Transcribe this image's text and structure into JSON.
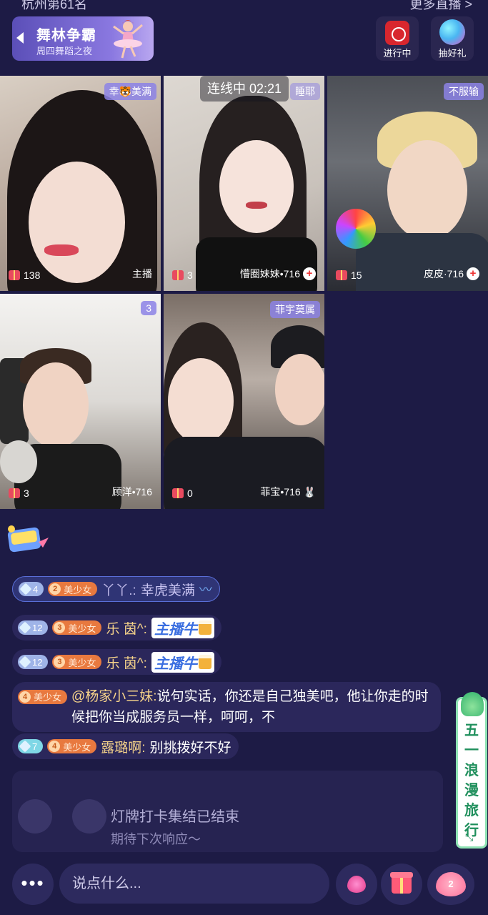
{
  "status": {
    "location": "杭州第61名",
    "more_live": "更多直播 >"
  },
  "event": {
    "title": "舞林争霸",
    "subtitle": "周四舞蹈之夜"
  },
  "top_buttons": {
    "live": "进行中",
    "gift": "抽好礼"
  },
  "timer": "连线中 02:21",
  "tiles": [
    {
      "badge": "幸🐯美满",
      "gift_count": "138",
      "name": "主播",
      "plus": false
    },
    {
      "badge": "睡耶",
      "gift_count": "3",
      "name": "懵圈妹妹•716",
      "plus": true
    },
    {
      "badge": "不服输",
      "gift_count": "15",
      "name": "皮皮·716",
      "plus": true
    },
    {
      "badge": "3",
      "gift_count": "3",
      "name": "顾洋•716",
      "plus": false
    },
    {
      "badge": "菲宇莫属",
      "gift_count": "0",
      "name": "菲宝•716 🐰",
      "plus": false
    }
  ],
  "chat": [
    {
      "level": "4",
      "fan_level": "2",
      "fan_label": "美少女",
      "user": "丫丫.:",
      "message": "幸虎美满"
    },
    {
      "level": "12",
      "fan_level": "3",
      "fan_label": "美少女",
      "user": "乐 茵^:",
      "sticker": "主播牛"
    },
    {
      "level": "12",
      "fan_level": "3",
      "fan_label": "美少女",
      "user": "乐 茵^:",
      "sticker": "主播牛"
    },
    {
      "fan_level": "4",
      "fan_label": "美少女",
      "user": "@杨家小三妹:",
      "message": "说句实话，你还是自己独美吧，他让你走的时候把你当成服务员一样，呵呵，不"
    },
    {
      "level": "7",
      "fan_level": "4",
      "fan_label": "美少女",
      "user": "露璐啊:",
      "message": "别挑拨好不好"
    }
  ],
  "notice": {
    "line1": "灯牌打卡集结已结束",
    "line2": "期待下次响应～"
  },
  "travel_banner": {
    "text": "五一浪漫旅行",
    "expand": "⤡"
  },
  "bottom": {
    "more": "•••",
    "input_placeholder": "说点什么...",
    "like_count": "2"
  }
}
